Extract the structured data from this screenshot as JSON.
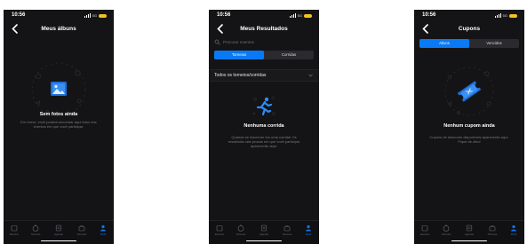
{
  "screens": [
    {
      "time": "10:56",
      "network": "5G",
      "title": "Meus álbuns",
      "empty_title": "Sem fotos ainda",
      "empty_desc": "Em breve, você poderá encontrar aqui fotos dos eventos em que você participar."
    },
    {
      "time": "10:56",
      "network": "5G",
      "title": "Meus Resultados",
      "search_placeholder": "Procurar eventos",
      "segments": [
        "Torneios",
        "Corridas"
      ],
      "filter_label": "Todos os torneios/corridas",
      "empty_title": "Nenhuma corrida",
      "empty_desc": "Quando se inscrever em uma corrida! Os resultados das provas em que você participar aparecerão aqui."
    },
    {
      "time": "10:56",
      "network": "5G",
      "title": "Cupons",
      "segments": [
        "Ativos",
        "Vencidos"
      ],
      "empty_title": "Nenhum cupom ainda",
      "empty_desc": "Cupons de desconto disponíveis aparecerão aqui. Fique de olho!"
    }
  ],
  "tab_bar": {
    "items": [
      "Eventos",
      "Torneios",
      "Agenda",
      "Torneios",
      "Perfil"
    ],
    "active_index": 4
  },
  "colors": {
    "accent": "#0a79f5",
    "background": "#141416",
    "battery": "#f2c31a"
  }
}
